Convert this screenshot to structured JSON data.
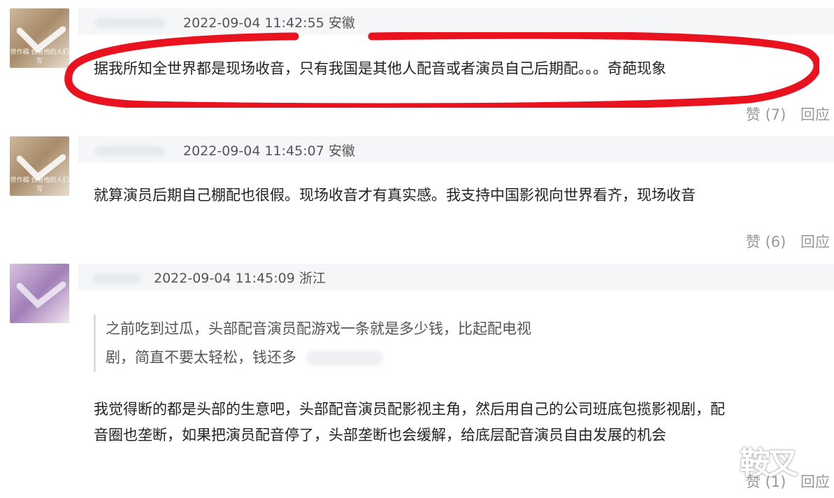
{
  "comments": [
    {
      "timestamp": "2022-09-04 11:42:55",
      "location": "安徽",
      "avatar_caption": "世作稿 台看他的人们写",
      "text": "据我所知全世界都是现场收音，只有我国是其他人配音或者演员自己后期配。。。奇葩现象",
      "like_label": "赞 (7)",
      "reply_label": "回应"
    },
    {
      "timestamp": "2022-09-04 11:45:07",
      "location": "安徽",
      "avatar_caption": "世作稿 台看他的人们写",
      "text": "就算演员后期自己棚配也很假。现场收音才有真实感。我支持中国影视向世界看齐，现场收音",
      "like_label": "赞 (6)",
      "reply_label": "回应"
    },
    {
      "timestamp": "2022-09-04 11:45:09",
      "location": "浙江",
      "quote_line1": "之前吃到过瓜，头部配音演员配游戏一条就是多少钱，比起配电视",
      "quote_line2": "剧，简直不要太轻松，钱还多",
      "text_line1": "我觉得断的都是头部的生意吧，头部配音演员配影视主角，然后用自己的公司班底包揽影视剧，配",
      "text_line2": "音圈也垄断，如果把演员配音停了，头部垄断也会缓解，给底层配音演员自由发展的机会",
      "like_label": "赞 (1)",
      "reply_label": "回应"
    }
  ],
  "watermark": "鞍叉",
  "colors": {
    "highlight_ellipse": "#e8131f",
    "meta_bar": "#f4f6f8",
    "action_text": "#999999"
  },
  "icons": [
    "avatar-image",
    "checkmark-overlay-icon"
  ]
}
